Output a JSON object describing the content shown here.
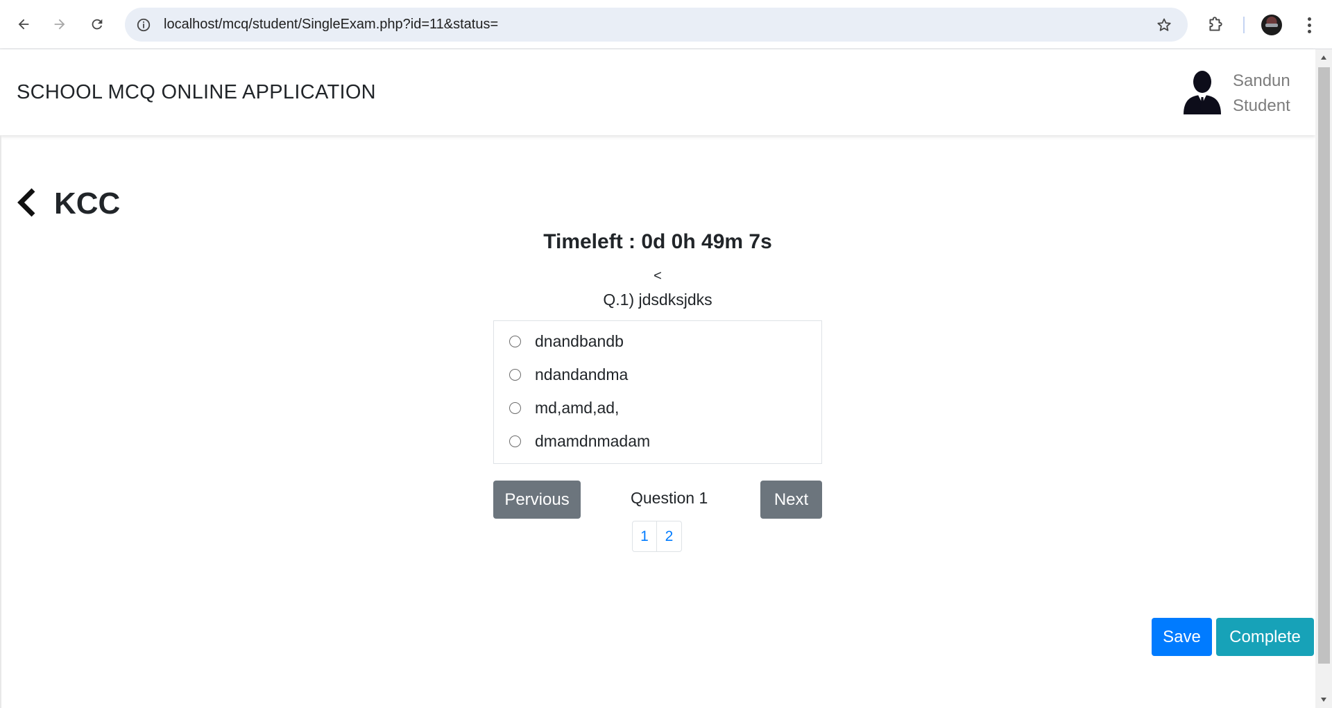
{
  "browser": {
    "url": "localhost/mcq/student/SingleExam.php?id=11&status="
  },
  "header": {
    "app_title": "SCHOOL MCQ ONLINE APPLICATION",
    "user_name": "Sandun",
    "user_role": "Student"
  },
  "exam": {
    "title": "KCC",
    "timeleft": "Timeleft : 0d 0h 49m 7s",
    "prev_char": "<",
    "question": "Q.1) jdsdksjdks",
    "options": [
      "dnandbandb",
      "ndandandma",
      "md,amd,ad,",
      "dmamdnmadam"
    ],
    "prev_label": "Pervious",
    "next_label": "Next",
    "question_indicator": "Question 1",
    "pages": [
      "1",
      "2"
    ],
    "save_label": "Save",
    "complete_label": "Complete"
  },
  "colors": {
    "primary": "#007bff",
    "info": "#17a2b8",
    "secondary": "#6c757d"
  }
}
